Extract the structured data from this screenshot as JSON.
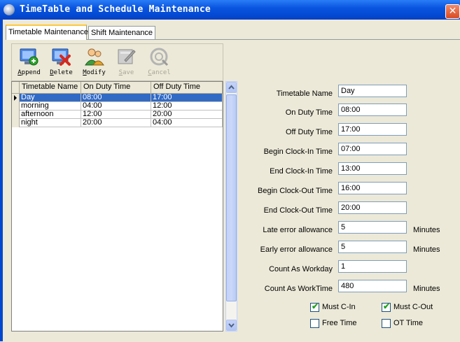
{
  "window": {
    "title": "TimeTable and Schedule Maintenance",
    "close_glyph": "✕"
  },
  "tabs": [
    {
      "label": "Timetable Maintenance",
      "active": true
    },
    {
      "label": "Shift Maintenance",
      "active": false
    }
  ],
  "toolbar": {
    "buttons": [
      {
        "label": "Append",
        "icon": "append-icon",
        "enabled": true
      },
      {
        "label": "Delete",
        "icon": "delete-icon",
        "enabled": true
      },
      {
        "label": "Modify",
        "icon": "modify-icon",
        "enabled": true
      },
      {
        "label": "Save",
        "icon": "save-icon",
        "enabled": false
      },
      {
        "label": "Cancel",
        "icon": "cancel-icon",
        "enabled": false
      }
    ]
  },
  "grid": {
    "columns": [
      "Timetable Name",
      "On Duty Time",
      "Off Duty Time"
    ],
    "rows": [
      [
        "Day",
        "08:00",
        "17:00"
      ],
      [
        "morning",
        "04:00",
        "12:00"
      ],
      [
        "afternoon",
        "12:00",
        "20:00"
      ],
      [
        "night",
        "20:00",
        "04:00"
      ]
    ],
    "selected_row": 0
  },
  "form": {
    "timetable_name": {
      "label": "Timetable Name",
      "value": "Day"
    },
    "on_duty_time": {
      "label": "On Duty Time",
      "value": "08:00"
    },
    "off_duty_time": {
      "label": "Off Duty Time",
      "value": "17:00"
    },
    "begin_clock_in": {
      "label": "Begin Clock-In Time",
      "value": "07:00"
    },
    "end_clock_in": {
      "label": "End Clock-In Time",
      "value": "13:00"
    },
    "begin_clock_out": {
      "label": "Begin Clock-Out Time",
      "value": "16:00"
    },
    "end_clock_out": {
      "label": "End Clock-Out Time",
      "value": "20:00"
    },
    "late_allowance": {
      "label": "Late error allowance",
      "value": "5",
      "unit": "Minutes"
    },
    "early_allowance": {
      "label": "Early error allowance",
      "value": "5",
      "unit": "Minutes"
    },
    "count_as_workday": {
      "label": "Count As Workday",
      "value": "1"
    },
    "count_as_worktime": {
      "label": "Count As WorkTime",
      "value": "480",
      "unit": "Minutes"
    }
  },
  "checkboxes": {
    "must_c_in": {
      "label": "Must C-In",
      "checked": true
    },
    "must_c_out": {
      "label": "Must C-Out",
      "checked": true
    },
    "free_time": {
      "label": "Free Time",
      "checked": false
    },
    "ot_time": {
      "label": "OT Time",
      "checked": false
    },
    "check_glyph": "✔"
  }
}
